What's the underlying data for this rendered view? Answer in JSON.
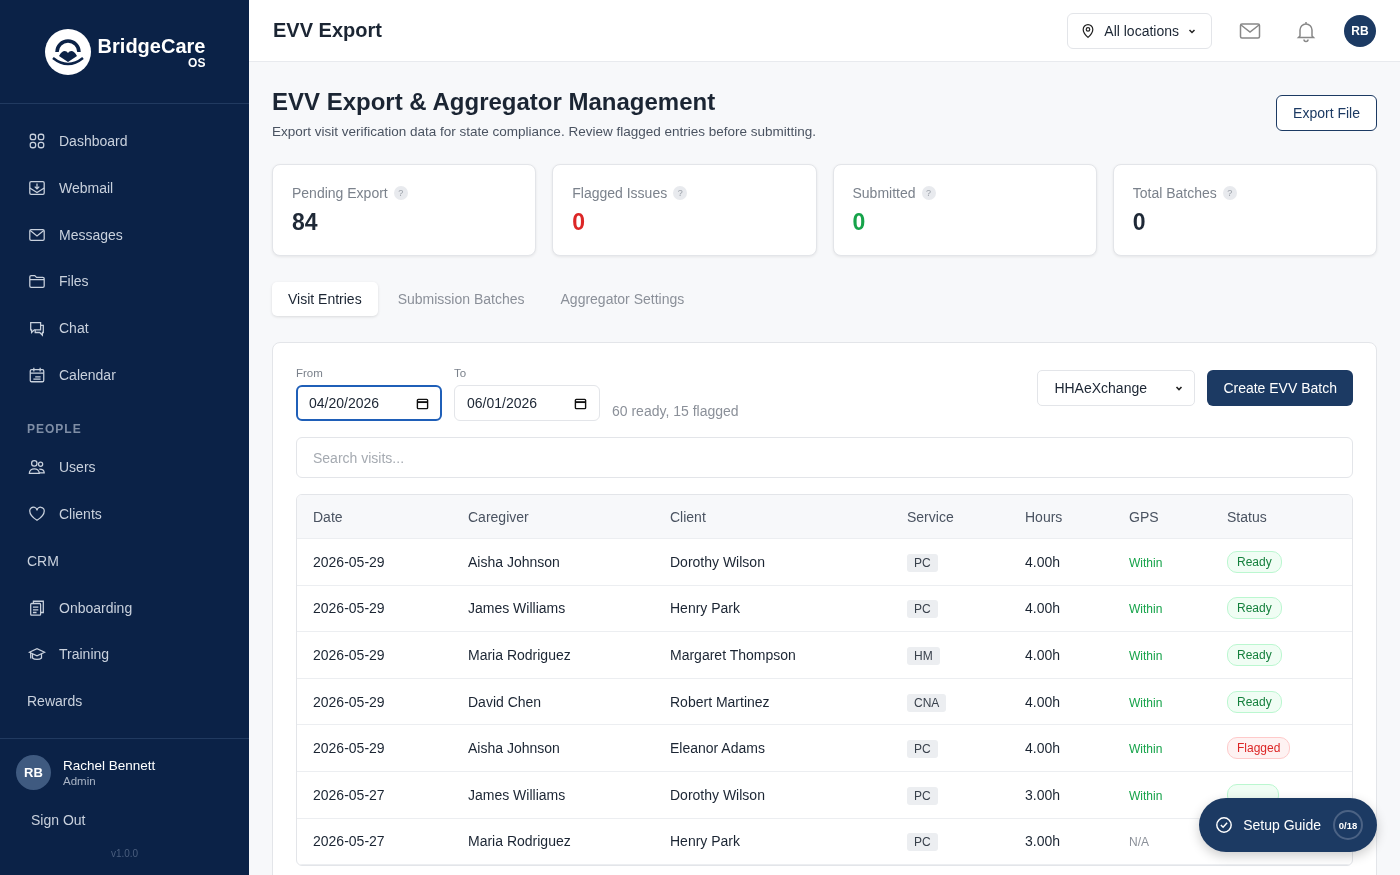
{
  "brand": {
    "name": "BridgeCare",
    "suffix": "OS"
  },
  "sidebar": {
    "items": [
      {
        "label": "Dashboard",
        "selected": false
      },
      {
        "label": "Webmail",
        "selected": false
      },
      {
        "label": "Messages",
        "selected": false
      },
      {
        "label": "Files",
        "selected": false
      },
      {
        "label": "Chat",
        "selected": false
      },
      {
        "label": "Calendar",
        "selected": false
      }
    ],
    "section": "PEOPLE",
    "people_items": [
      {
        "label": "Users",
        "selected": false
      },
      {
        "label": "Clients",
        "selected": false
      },
      {
        "label": "CRM",
        "selected": false
      },
      {
        "label": "Onboarding",
        "selected": false
      },
      {
        "label": "Training",
        "selected": false
      },
      {
        "label": "Rewards",
        "selected": false
      }
    ],
    "user": {
      "initials": "RB",
      "name": "Rachel Bennett",
      "role": "Admin"
    },
    "sign_out": "Sign Out",
    "version": "v1.0.0"
  },
  "header": {
    "title": "EVV Export",
    "location": "All locations",
    "avatar": "RB"
  },
  "page": {
    "title": "EVV Export & Aggregator Management",
    "subtitle": "Export visit verification data for state compliance. Review flagged entries before submitting.",
    "export_button": "Export File"
  },
  "stats": [
    {
      "label": "Pending Export",
      "help": "?",
      "value": "84",
      "color": "#1f2937"
    },
    {
      "label": "Flagged Issues",
      "help": "?",
      "value": "0",
      "color": "#dc2626"
    },
    {
      "label": "Submitted",
      "help": "?",
      "value": "0",
      "color": "#16a34a"
    },
    {
      "label": "Total Batches",
      "help": "?",
      "value": "0",
      "color": "#1f2937"
    }
  ],
  "tabs": [
    {
      "label": "Visit Entries",
      "selected": true
    },
    {
      "label": "Submission Batches",
      "selected": false
    },
    {
      "label": "Aggregator Settings",
      "selected": false
    }
  ],
  "filters": {
    "from": {
      "label": "From",
      "value": "04/20/2026",
      "focused": true
    },
    "to": {
      "label": "To",
      "value": "06/01/2026",
      "focused": false
    },
    "summary": "60 ready, 15 flagged",
    "aggregator": "HHAeXchange",
    "create_button": "Create EVV Batch",
    "search": {
      "placeholder": "Search visits..."
    }
  },
  "table": {
    "columns": [
      "Date",
      "Caregiver",
      "Client",
      "Service",
      "Hours",
      "GPS",
      "Status"
    ],
    "rows": [
      {
        "date": "2026-05-29",
        "caregiver": "Aisha Johnson",
        "client": "Dorothy Wilson",
        "service": "PC",
        "hours": "4.00h",
        "gps": {
          "text": "Within",
          "kind": "within"
        },
        "status": {
          "text": "Ready",
          "kind": "ready"
        }
      },
      {
        "date": "2026-05-29",
        "caregiver": "James Williams",
        "client": "Henry Park",
        "service": "PC",
        "hours": "4.00h",
        "gps": {
          "text": "Within",
          "kind": "within"
        },
        "status": {
          "text": "Ready",
          "kind": "ready"
        }
      },
      {
        "date": "2026-05-29",
        "caregiver": "Maria Rodriguez",
        "client": "Margaret Thompson",
        "service": "HM",
        "hours": "4.00h",
        "gps": {
          "text": "Within",
          "kind": "within"
        },
        "status": {
          "text": "Ready",
          "kind": "ready"
        }
      },
      {
        "date": "2026-05-29",
        "caregiver": "David Chen",
        "client": "Robert Martinez",
        "service": "CNA",
        "hours": "4.00h",
        "gps": {
          "text": "Within",
          "kind": "within"
        },
        "status": {
          "text": "Ready",
          "kind": "ready"
        }
      },
      {
        "date": "2026-05-29",
        "caregiver": "Aisha Johnson",
        "client": "Eleanor Adams",
        "service": "PC",
        "hours": "4.00h",
        "gps": {
          "text": "Within",
          "kind": "within"
        },
        "status": {
          "text": "Flagged",
          "kind": "flagged"
        }
      },
      {
        "date": "2026-05-27",
        "caregiver": "James Williams",
        "client": "Dorothy Wilson",
        "service": "PC",
        "hours": "3.00h",
        "gps": {
          "text": "Within",
          "kind": "within"
        },
        "status": {
          "kind": "ready"
        }
      },
      {
        "date": "2026-05-27",
        "caregiver": "Maria Rodriguez",
        "client": "Henry Park",
        "service": "PC",
        "hours": "3.00h",
        "gps": {
          "text": "N/A",
          "kind": "none"
        }
      }
    ]
  },
  "setup_guide": {
    "label": "Setup Guide",
    "progress": "0/18"
  }
}
